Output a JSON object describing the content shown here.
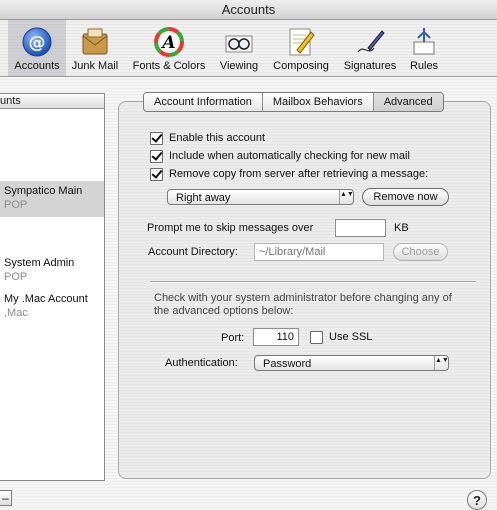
{
  "window": {
    "title": "Accounts"
  },
  "toolbar": {
    "items": [
      {
        "label": "Accounts",
        "icon": "at-sign-icon",
        "selected": true
      },
      {
        "label": "Junk Mail",
        "icon": "junk-mail-icon",
        "selected": false
      },
      {
        "label": "Fonts & Colors",
        "icon": "fonts-colors-icon",
        "selected": false
      },
      {
        "label": "Viewing",
        "icon": "viewing-glasses-icon",
        "selected": false
      },
      {
        "label": "Composing",
        "icon": "composing-pencil-icon",
        "selected": false
      },
      {
        "label": "Signatures",
        "icon": "signature-pen-icon",
        "selected": false
      },
      {
        "label": "Rules",
        "icon": "rules-icon",
        "selected": false
      }
    ]
  },
  "sidebar": {
    "header": "unts",
    "accounts": [
      {
        "name": "Sympatico Main",
        "type": "POP",
        "selected": true
      },
      {
        "name": "System Admin",
        "type": "POP",
        "selected": false
      },
      {
        "name": "My .Mac Account",
        "type": ".Mac",
        "selected": false
      }
    ],
    "minus_label": "–"
  },
  "tabs": [
    {
      "label": "Account Information",
      "active": false
    },
    {
      "label": "Mailbox Behaviors",
      "active": false
    },
    {
      "label": "Advanced",
      "active": true
    }
  ],
  "advanced": {
    "enable_account": {
      "label": "Enable this account",
      "checked": true
    },
    "include_checking": {
      "label": "Include when automatically checking for new mail",
      "checked": true
    },
    "remove_copy": {
      "label": "Remove copy from server after retrieving a message:",
      "checked": true
    },
    "remove_when": {
      "value": "Right away",
      "arrows": "▲▼"
    },
    "remove_now_label": "Remove now",
    "skip_prompt": {
      "label": "Prompt me to skip messages over",
      "value": "",
      "unit": "KB"
    },
    "account_directory": {
      "label": "Account Directory:",
      "value": "~/Library/Mail",
      "choose_label": "Choose"
    },
    "admin_note_line1": "Check with your system administrator before changing any of",
    "admin_note_line2": "the advanced options below:",
    "port": {
      "label": "Port:",
      "value": "110"
    },
    "ssl": {
      "label": "Use SSL",
      "checked": false
    },
    "authentication": {
      "label": "Authentication:",
      "value": "Password",
      "arrows": "▲▼"
    }
  },
  "help": {
    "label": "?"
  }
}
